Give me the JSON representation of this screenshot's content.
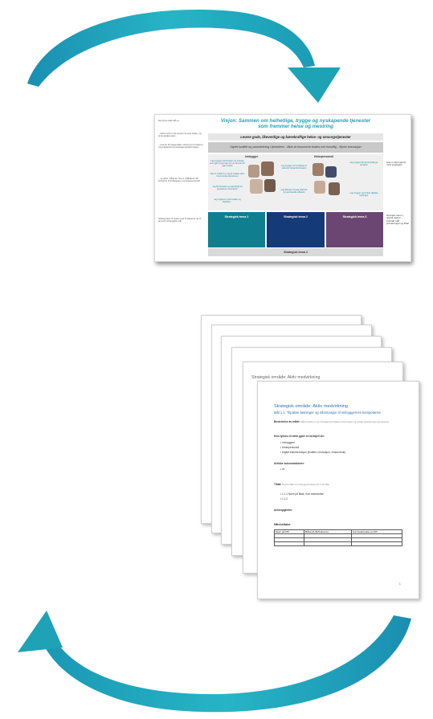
{
  "colors": {
    "arrow": "#1ea2b6",
    "arrow_light": "#7dd3e0",
    "title_teal": "#1aa6b7",
    "strat1": "#0f7f90",
    "strat2": "#143a78",
    "strat3": "#6b4673",
    "strat_footer": "#d9d9d9"
  },
  "slide": {
    "title_line1": "Visjon: Sammen om helhetlige, trygge og nyskapende tjenester",
    "title_line2": "som fremmer helse og mestring",
    "band1": "Levere gode, likeverdige og bærekraftige helse- og omsorgstjenester",
    "band2": "Styrke kvalitet og sammenheng i tjenestene - Økte at ressursene brukes mer fornuftig - Styrke innovasjon",
    "left_notes": [
      "Det å ha uttalt MÅ er...",
      "...betta små rol de sentrer henete helse- og omsorgstjenester...",
      "...grunne tilt stagerabler mirbreg for brukeren med digital kommunikasjon(elektroniske)",
      "...og gitter målet for hva vi målbakom får fortsarne til brukeggere og Helsepersonell",
      "Strategi ikke til region ned til plassere og til grovest strategiske mål"
    ],
    "col_left_title": "Innbygger",
    "col_right_title": "Helsepersonell",
    "bubbles_left": [
      "Lag trygger informasjon og verktøy som gjør at jeg kan ta mer ansvar for egen helse",
      "Det er enkelt for meg å snakke dem kommunale tjenestene",
      "Jeg får kontakt og rask hjelp fra tjenestene ved behov",
      "Jeg opplever god kvalitet og tilpasset..."
    ],
    "bubbles_right": [
      "Lag trygger at ha tilgang til relevant helseinformasjon",
      "Lag tilbuder rimelig tidsbruk og samhandle effektivt",
      "Lag trygger på samhandlings-portalen",
      "Lag trygger og bruker digitale løsninger"
    ],
    "right_notes_top": "Hva vi skal oppnå med strategien",
    "right_notes_bottom": "Hvordan skal vi oppnå dette? - Fortsatt mål, prioriteringer og tiltak",
    "strategies": [
      "Strategisk tema 1",
      "Strategisk tema 2",
      "Strategisk tema 3"
    ],
    "strategy_footer": "Strategisk tema 4"
  },
  "doc": {
    "back_header": "Strategisk område: Aktiv medvirkning",
    "title": "Strategisk område: Aktiv medvirkning",
    "subtitle": "Mål 1.1: Tilpasse løsninger og informasjon til innbyggernes kompetanse",
    "section1_label": "Beskrivelse av målet:",
    "section1_text": "Målet handler om at innbyggere får tilgang til informasjon og verktøy tilpasset egen kompetanse.",
    "section2_label": "Hvis lykkes vil dette gjøre en forskjell for:",
    "bullets": [
      "Innbyggere",
      "Helsepersonell",
      "Digital transformasjon (kvalitet, innovasjon, ressursbruk)"
    ],
    "section3_label": "Kritiske suksessfaktorer:",
    "section3_bullet": "xx",
    "section4_label": "Tiltak:",
    "section4_text": "Beskriv tiltak som skal gjennomføres for å nå målet.",
    "section4_bullets": [
      "1.1.1 Noen på tiltak: Kort beskrivelse",
      "1.1.2"
    ],
    "section5_label": "Avhengigheter:",
    "section6_label": "Måleindikator:",
    "table_headers": [
      "Navn på KPI",
      "Målverdi (år/frekvens)",
      "Kort beskrivelse av KPI"
    ],
    "page_number": "1"
  }
}
